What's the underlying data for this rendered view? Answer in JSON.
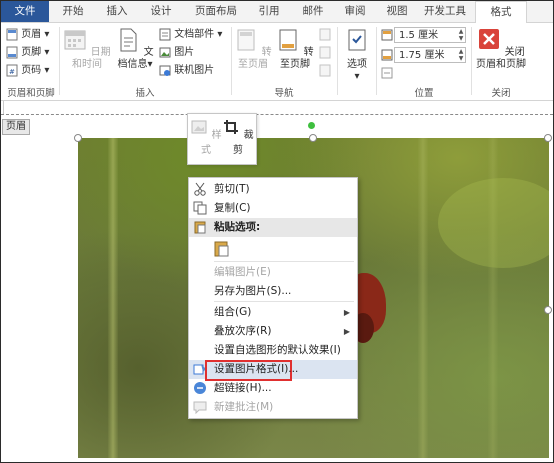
{
  "tabs": [
    {
      "label": "文件"
    },
    {
      "label": "开始"
    },
    {
      "label": "插入"
    },
    {
      "label": "设计"
    },
    {
      "label": "页面布局"
    },
    {
      "label": "引用"
    },
    {
      "label": "邮件"
    },
    {
      "label": "审阅"
    },
    {
      "label": "视图"
    },
    {
      "label": "开发工具"
    },
    {
      "label": "格式"
    }
  ],
  "ribbon": {
    "header_footer_group": {
      "items": [
        "页眉",
        "页脚",
        "页码"
      ],
      "label": "页眉和页脚"
    },
    "insert_group": {
      "datetime": "日期和时间",
      "docinfo": "文档信息",
      "docparts": "文档部件",
      "picture": "图片",
      "online_picture": "联机图片",
      "label": "插入"
    },
    "nav_group": {
      "goto_header": "转至页眉",
      "goto_footer": "转至页脚",
      "label": "导航"
    },
    "options_group": {
      "options": "选项"
    },
    "position_group": {
      "top_value": "1.5 厘米",
      "bottom_value": "1.75 厘米",
      "label": "位置"
    },
    "close_group": {
      "close_line1": "关闭",
      "close_line2": "页眉和页脚",
      "label": "关闭"
    }
  },
  "doc": {
    "header_tag": "页眉"
  },
  "mini_toolbar": {
    "style": "样式",
    "crop": "裁剪"
  },
  "context_menu": {
    "items": [
      {
        "label": "剪切(T)",
        "icon": "scissors-icon"
      },
      {
        "label": "复制(C)",
        "icon": "copy-icon"
      },
      {
        "label": "粘贴选项:",
        "icon": "paste-icon"
      },
      {
        "label": "编辑图片(E)"
      },
      {
        "label": "另存为图片(S)..."
      },
      {
        "label": "组合(G)"
      },
      {
        "label": "叠放次序(R)"
      },
      {
        "label": "设置自选图形的默认效果(I)"
      },
      {
        "label": "设置图片格式(I)...",
        "icon": "format-picture-icon"
      },
      {
        "label": "超链接(H)...",
        "icon": "hyperlink-icon"
      },
      {
        "label": "新建批注(M)",
        "icon": "comment-icon"
      }
    ]
  },
  "colors": {
    "file_tab": "#2b579a",
    "highlight": "#dbe4f1",
    "red_box": "#e03030",
    "close_icon": "#d9433a"
  }
}
